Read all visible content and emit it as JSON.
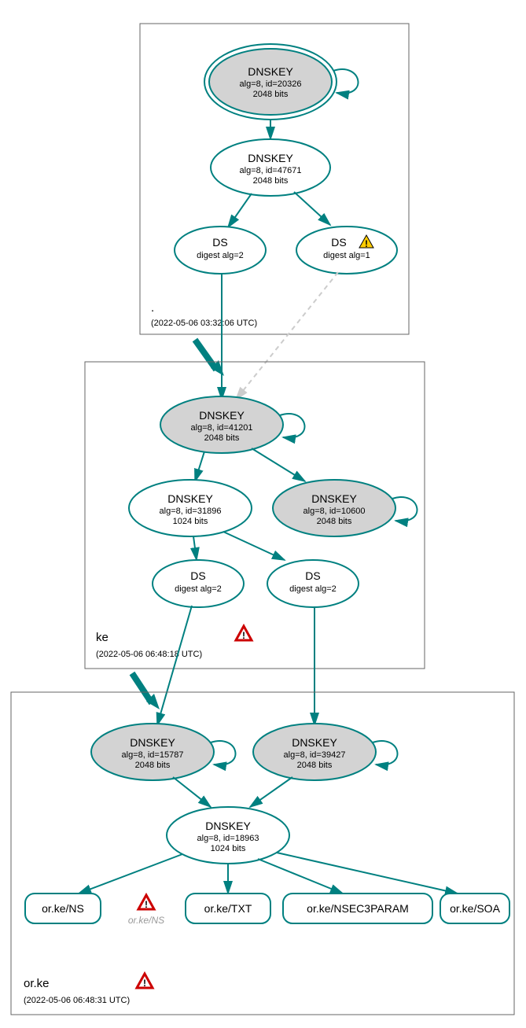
{
  "zones": {
    "root": {
      "name": ".",
      "timestamp": "(2022-05-06 03:32:06 UTC)",
      "dnskey_ksk": {
        "title": "DNSKEY",
        "sub1": "alg=8, id=20326",
        "sub2": "2048 bits"
      },
      "dnskey_zsk": {
        "title": "DNSKEY",
        "sub1": "alg=8, id=47671",
        "sub2": "2048 bits"
      },
      "ds1": {
        "title": "DS",
        "sub": "digest alg=2"
      },
      "ds2": {
        "title": "DS",
        "sub": "digest alg=1"
      }
    },
    "ke": {
      "name": "ke",
      "timestamp": "(2022-05-06 06:48:18 UTC)",
      "dnskey_ksk": {
        "title": "DNSKEY",
        "sub1": "alg=8, id=41201",
        "sub2": "2048 bits"
      },
      "dnskey_zsk": {
        "title": "DNSKEY",
        "sub1": "alg=8, id=31896",
        "sub2": "1024 bits"
      },
      "dnskey_extra": {
        "title": "DNSKEY",
        "sub1": "alg=8, id=10600",
        "sub2": "2048 bits"
      },
      "ds1": {
        "title": "DS",
        "sub": "digest alg=2"
      },
      "ds2": {
        "title": "DS",
        "sub": "digest alg=2"
      }
    },
    "orke": {
      "name": "or.ke",
      "timestamp": "(2022-05-06 06:48:31 UTC)",
      "dnskey_ksk1": {
        "title": "DNSKEY",
        "sub1": "alg=8, id=15787",
        "sub2": "2048 bits"
      },
      "dnskey_ksk2": {
        "title": "DNSKEY",
        "sub1": "alg=8, id=39427",
        "sub2": "2048 bits"
      },
      "dnskey_zsk": {
        "title": "DNSKEY",
        "sub1": "alg=8, id=18963",
        "sub2": "1024 bits"
      },
      "rr_ns": "or.ke/NS",
      "rr_ns_ghost": "or.ke/NS",
      "rr_txt": "or.ke/TXT",
      "rr_nsec3": "or.ke/NSEC3PARAM",
      "rr_soa": "or.ke/SOA"
    }
  }
}
